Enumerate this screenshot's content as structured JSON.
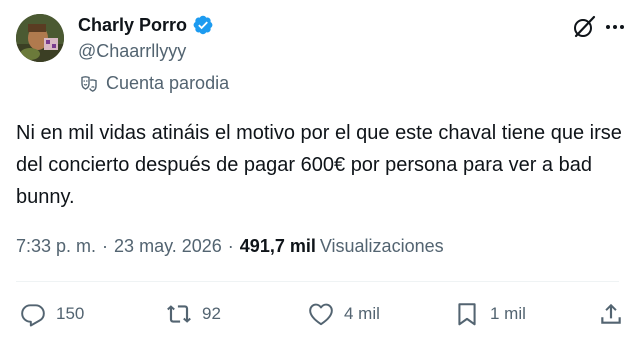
{
  "author": {
    "display_name": "Charly Porro",
    "handle": "@Chaarrllyyy",
    "parody_label": "Cuenta parodia",
    "verified_color": "#1d9bf0"
  },
  "icons": {
    "verified": "verified-badge-icon",
    "parody": "theater-masks-icon",
    "grok": "grok-icon",
    "more": "more-dots-icon",
    "reply": "reply-icon",
    "retweet": "retweet-icon",
    "like": "heart-icon",
    "bookmark": "bookmark-icon",
    "share": "share-icon"
  },
  "tweet": {
    "text": "Ni en mil vidas atináis el motivo por el que este chaval tiene que irse del concierto después de pagar 600€ por persona para ver a bad bunny."
  },
  "meta": {
    "time": "7:33 p. m.",
    "separator": "·",
    "date": "23 may. 2026",
    "views_count": "491,7 mil",
    "views_label": "Visualizaciones"
  },
  "actions": {
    "replies": "150",
    "retweets": "92",
    "likes": "4 mil",
    "bookmarks": "1 mil"
  },
  "colors": {
    "text_primary": "#0f1419",
    "text_secondary": "#536471",
    "accent": "#1d9bf0"
  }
}
